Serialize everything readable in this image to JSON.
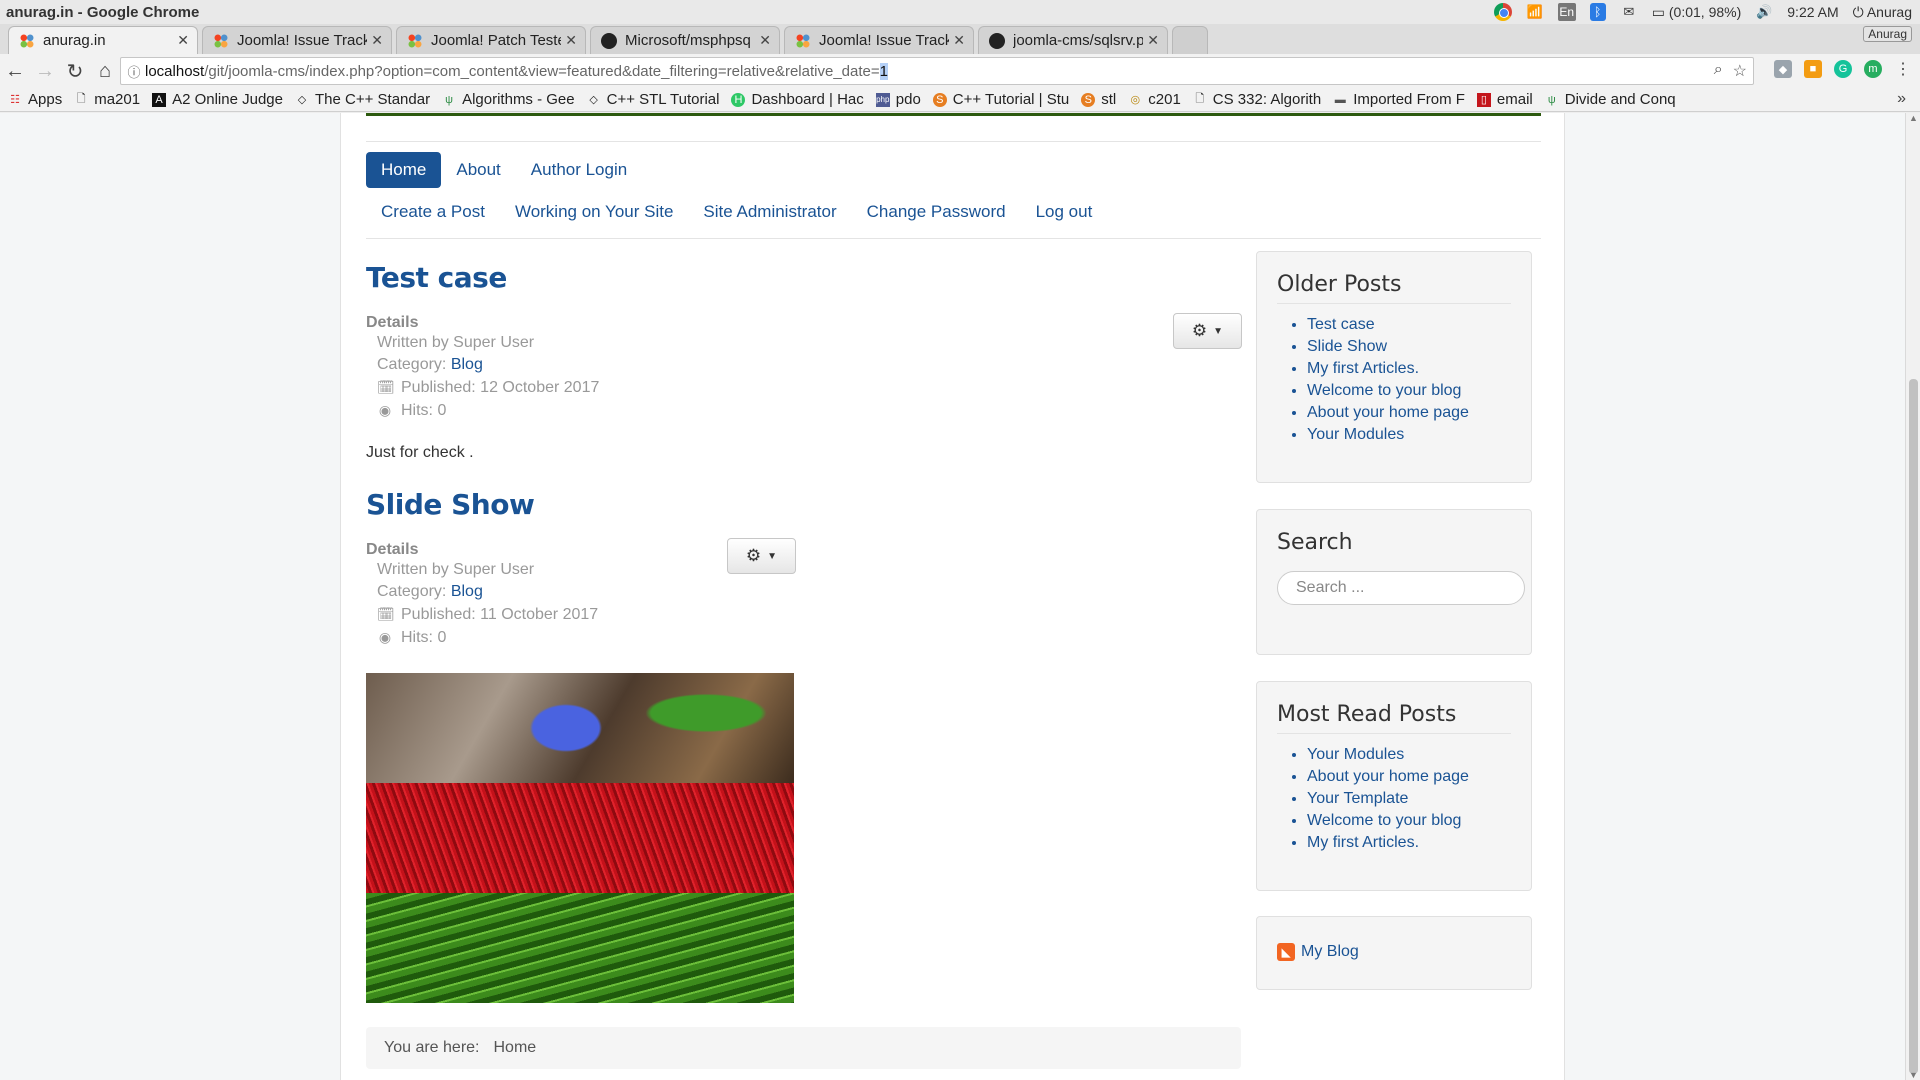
{
  "window": {
    "title": "anurag.in - Google Chrome"
  },
  "system_tray": {
    "keyboard_layout": "En",
    "battery": "(0:01, 98%)",
    "time": "9:22 AM",
    "user": "Anurag"
  },
  "tabs": [
    {
      "title": "anurag.in",
      "favicon": "joomla-icon",
      "active": true
    },
    {
      "title": "Joomla! Issue Track",
      "favicon": "joomla-icon",
      "active": false
    },
    {
      "title": "Joomla! Patch Teste",
      "favicon": "joomla-icon",
      "active": false
    },
    {
      "title": "Microsoft/msphpsq",
      "favicon": "github-icon",
      "active": false
    },
    {
      "title": "Joomla! Issue Track",
      "favicon": "joomla-icon",
      "active": false
    },
    {
      "title": "joomla-cms/sqlsrv.p",
      "favicon": "github-icon",
      "active": false
    }
  ],
  "profile_badge": "Anurag",
  "address_bar": {
    "host": "localhost",
    "path": "/git/joomla-cms/index.php?option=com_content&view=featured&date_filtering=relative&relative_date=",
    "selected": "1"
  },
  "bookmarks": [
    {
      "label": "Apps",
      "icon": "apps-grid-icon"
    },
    {
      "label": "ma201",
      "icon": "page-icon"
    },
    {
      "label": "A2 Online Judge",
      "icon": "a2-icon"
    },
    {
      "label": "The C++ Standar",
      "icon": "cpp-icon"
    },
    {
      "label": "Algorithms - Gee",
      "icon": "gfg-icon"
    },
    {
      "label": "C++ STL Tutorial",
      "icon": "cpp-icon"
    },
    {
      "label": "Dashboard | Hac",
      "icon": "hackerrank-icon"
    },
    {
      "label": "pdo",
      "icon": "php-icon"
    },
    {
      "label": "C++ Tutorial | Stu",
      "icon": "studytonight-icon"
    },
    {
      "label": "stl",
      "icon": "studytonight-icon"
    },
    {
      "label": "c201",
      "icon": "globe-icon"
    },
    {
      "label": "CS 332: Algorith",
      "icon": "page-icon"
    },
    {
      "label": "Imported From F",
      "icon": "folder-icon"
    },
    {
      "label": "email",
      "icon": "mail-icon"
    },
    {
      "label": "Divide and Conq",
      "icon": "gfg-icon"
    }
  ],
  "site": {
    "menu_main": [
      {
        "label": "Home",
        "active": true
      },
      {
        "label": "About",
        "active": false
      },
      {
        "label": "Author Login",
        "active": false
      }
    ],
    "menu_user": [
      "Create a Post",
      "Working on Your Site",
      "Site Administrator",
      "Change Password",
      "Log out"
    ],
    "articles": [
      {
        "title": "Test case",
        "details_label": "Details",
        "written_by": "Written by Super User",
        "category_prefix": "Category:",
        "category": "Blog",
        "published": "Published: 12 October 2017",
        "hits": "Hits: 0",
        "text": "Just for check  ."
      },
      {
        "title": "Slide Show",
        "details_label": "Details",
        "written_by": "Written by Super User",
        "category_prefix": "Category:",
        "category": "Blog",
        "published": "Published: 11 October 2017",
        "hits": "Hits: 0"
      }
    ],
    "breadcrumbs": {
      "prefix": "You are here:",
      "current": "Home"
    },
    "sidebar": {
      "older_posts": {
        "title": "Older Posts",
        "items": [
          "Test case",
          "Slide Show",
          "My first Articles.",
          "Welcome to your blog",
          "About your home page",
          "Your Modules"
        ]
      },
      "search": {
        "title": "Search",
        "placeholder": "Search ..."
      },
      "most_read": {
        "title": "Most Read Posts",
        "items": [
          "Your Modules",
          "About your home page",
          "Your Template",
          "Welcome to your blog",
          "My first Articles."
        ]
      },
      "feed": {
        "label": "My Blog"
      }
    }
  },
  "colors": {
    "link": "#1a5394",
    "active_pill": "#1a5394",
    "header_accent": "#2d5a0f"
  }
}
